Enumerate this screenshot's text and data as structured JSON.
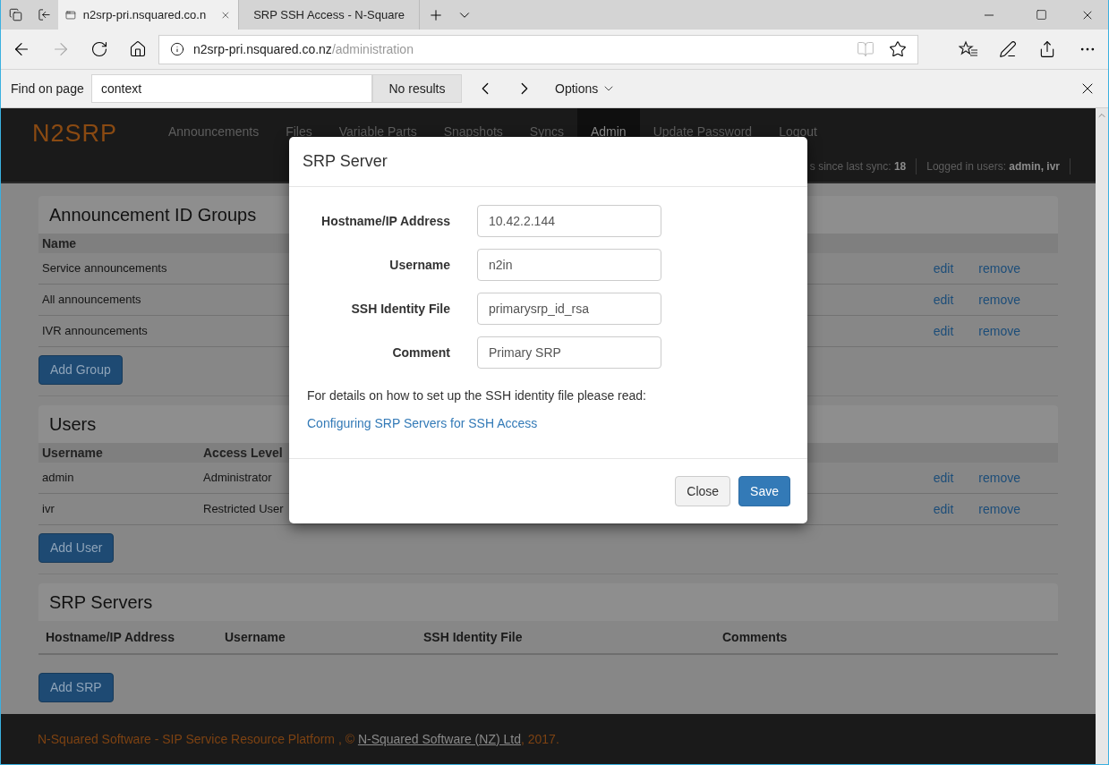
{
  "browser": {
    "tabs": [
      {
        "title": "n2srp-pri.nsquared.co.n",
        "selected": true
      },
      {
        "title": "SRP SSH Access - N-Square",
        "selected": false
      }
    ],
    "url": {
      "host": "n2srp-pri.nsquared.co.nz",
      "path": "/administration"
    },
    "find": {
      "label": "Find on page",
      "query": "context",
      "result": "No results",
      "options": "Options"
    }
  },
  "app": {
    "logo": "N2SRP",
    "nav": [
      {
        "label": "Announcements",
        "selected": false
      },
      {
        "label": "Files",
        "selected": false
      },
      {
        "label": "Variable Parts",
        "selected": false
      },
      {
        "label": "Snapshots",
        "selected": false
      },
      {
        "label": "Syncs",
        "selected": false
      },
      {
        "label": "Admin",
        "selected": true
      },
      {
        "label": "Update Password",
        "selected": false
      },
      {
        "label": "Logout",
        "selected": false
      }
    ],
    "status": [
      {
        "label": "s since last sync:",
        "value": "18"
      },
      {
        "label": "Logged in users:",
        "value": "admin, ivr"
      }
    ]
  },
  "groups": {
    "title": "Announcement ID Groups",
    "columns": [
      "Name"
    ],
    "rows": [
      {
        "name": "Service announcements",
        "actions": [
          "edit",
          "remove"
        ]
      },
      {
        "name": "All announcements",
        "actions": [
          "edit",
          "remove"
        ]
      },
      {
        "name": "IVR announcements",
        "actions": [
          "edit",
          "remove"
        ]
      }
    ],
    "button": "Add Group"
  },
  "users": {
    "title": "Users",
    "columns": [
      "Username",
      "Access Level"
    ],
    "rows": [
      {
        "username": "admin",
        "access": "Administrator",
        "actions": [
          "edit",
          "remove"
        ]
      },
      {
        "username": "ivr",
        "access": "Restricted User",
        "actions": [
          "edit",
          "remove"
        ]
      }
    ],
    "button": "Add User"
  },
  "servers": {
    "title": "SRP Servers",
    "columns": [
      "Hostname/IP Address",
      "Username",
      "SSH Identity File",
      "Comments"
    ],
    "button": "Add SRP"
  },
  "modal": {
    "title": "SRP Server",
    "fields": [
      {
        "label": "Hostname/IP Address",
        "value": "10.42.2.144"
      },
      {
        "label": "Username",
        "value": "n2in"
      },
      {
        "label": "SSH Identity File",
        "value": "primarysrp_id_rsa"
      },
      {
        "label": "Comment",
        "value": "Primary SRP"
      }
    ],
    "note": "For details on how to set up the SSH identity file please read:",
    "link": "Configuring SRP Servers for SSH Access",
    "buttons": [
      {
        "label": "Close",
        "kind": "default"
      },
      {
        "label": "Save",
        "kind": "primary"
      }
    ]
  },
  "footer": {
    "text": "N-Squared Software - SIP Service Resource Platform , ©",
    "link": "N-Squared Software (NZ) Ltd",
    "suffix": ", 2017."
  }
}
